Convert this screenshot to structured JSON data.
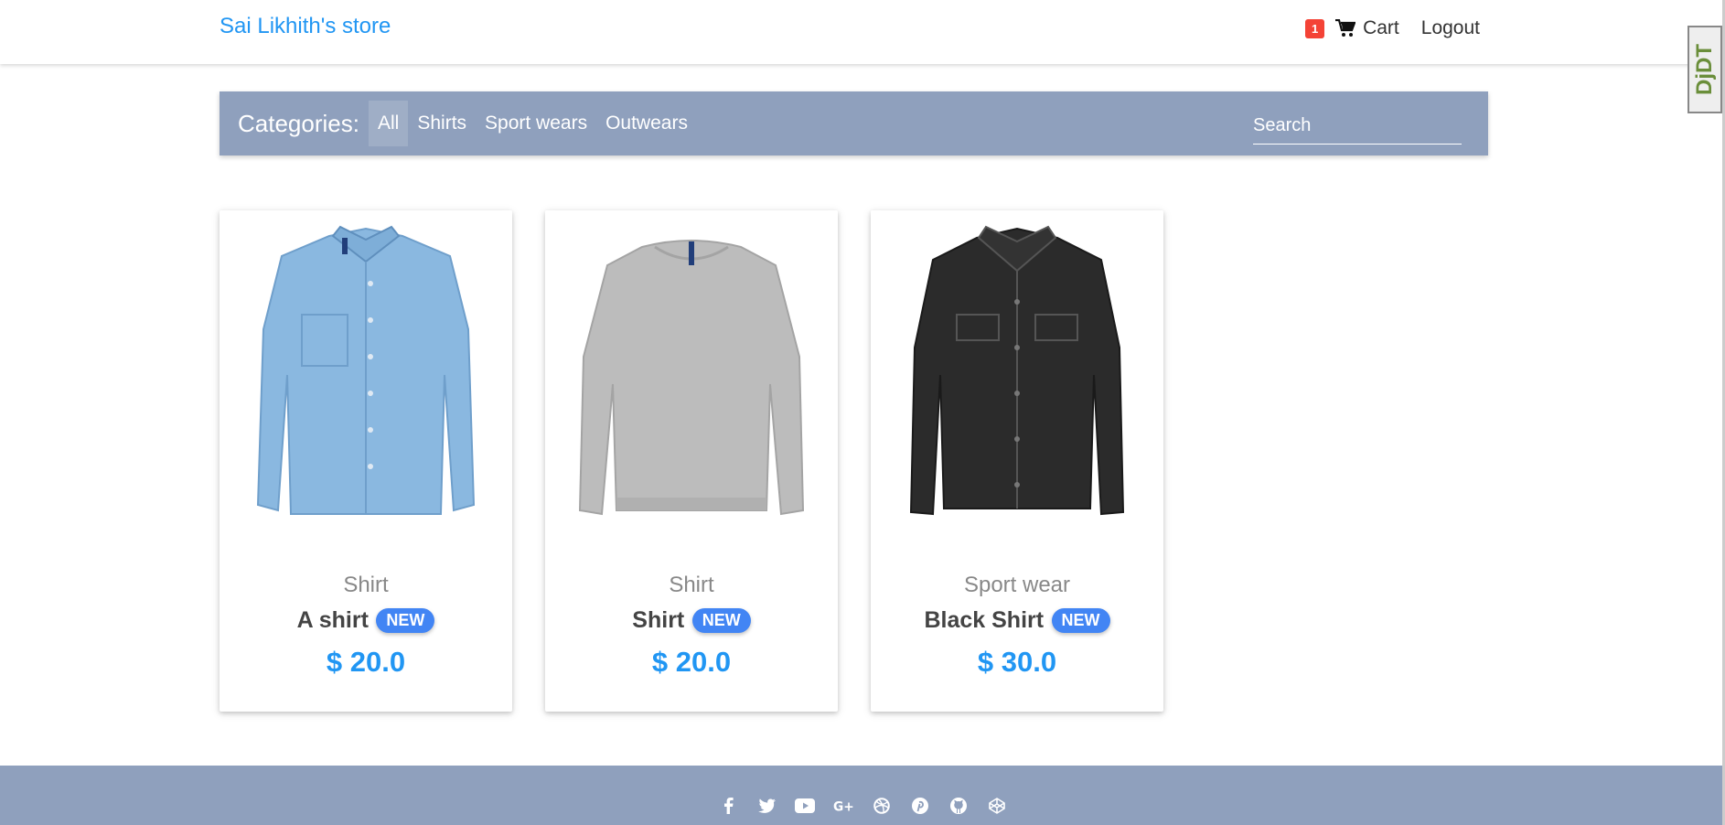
{
  "header": {
    "brand": "Sai Likhith's store",
    "cart_count": "1",
    "cart_label": "Cart",
    "logout_label": "Logout"
  },
  "categories": {
    "title": "Categories:",
    "tabs": [
      "All",
      "Shirts",
      "Sport wears",
      "Outwears"
    ],
    "active": "All",
    "search_placeholder": "Search"
  },
  "products": [
    {
      "category": "Shirt",
      "name": "A shirt",
      "badge": "NEW",
      "price": "$ 20.0",
      "image": "denim-shirt",
      "image_color": "#8ab8e0"
    },
    {
      "category": "Shirt",
      "name": "Shirt",
      "badge": "NEW",
      "price": "$ 20.0",
      "image": "grey-sweatshirt",
      "image_color": "#b9b9b9"
    },
    {
      "category": "Sport wear",
      "name": "Black Shirt",
      "badge": "NEW",
      "price": "$ 30.0",
      "image": "black-denim-jacket",
      "image_color": "#2b2b2b"
    }
  ],
  "footer": {
    "social_icons": [
      "facebook-icon",
      "twitter-icon",
      "youtube-icon",
      "google-plus-icon",
      "dribbble-icon",
      "pinterest-icon",
      "github-icon",
      "codepen-icon"
    ]
  },
  "devtool": {
    "label": "DjDT"
  },
  "colors": {
    "accent": "#2196f3",
    "bar": "#8fa0bd",
    "badge": "#4285f4",
    "cart_badge": "#f44336"
  }
}
